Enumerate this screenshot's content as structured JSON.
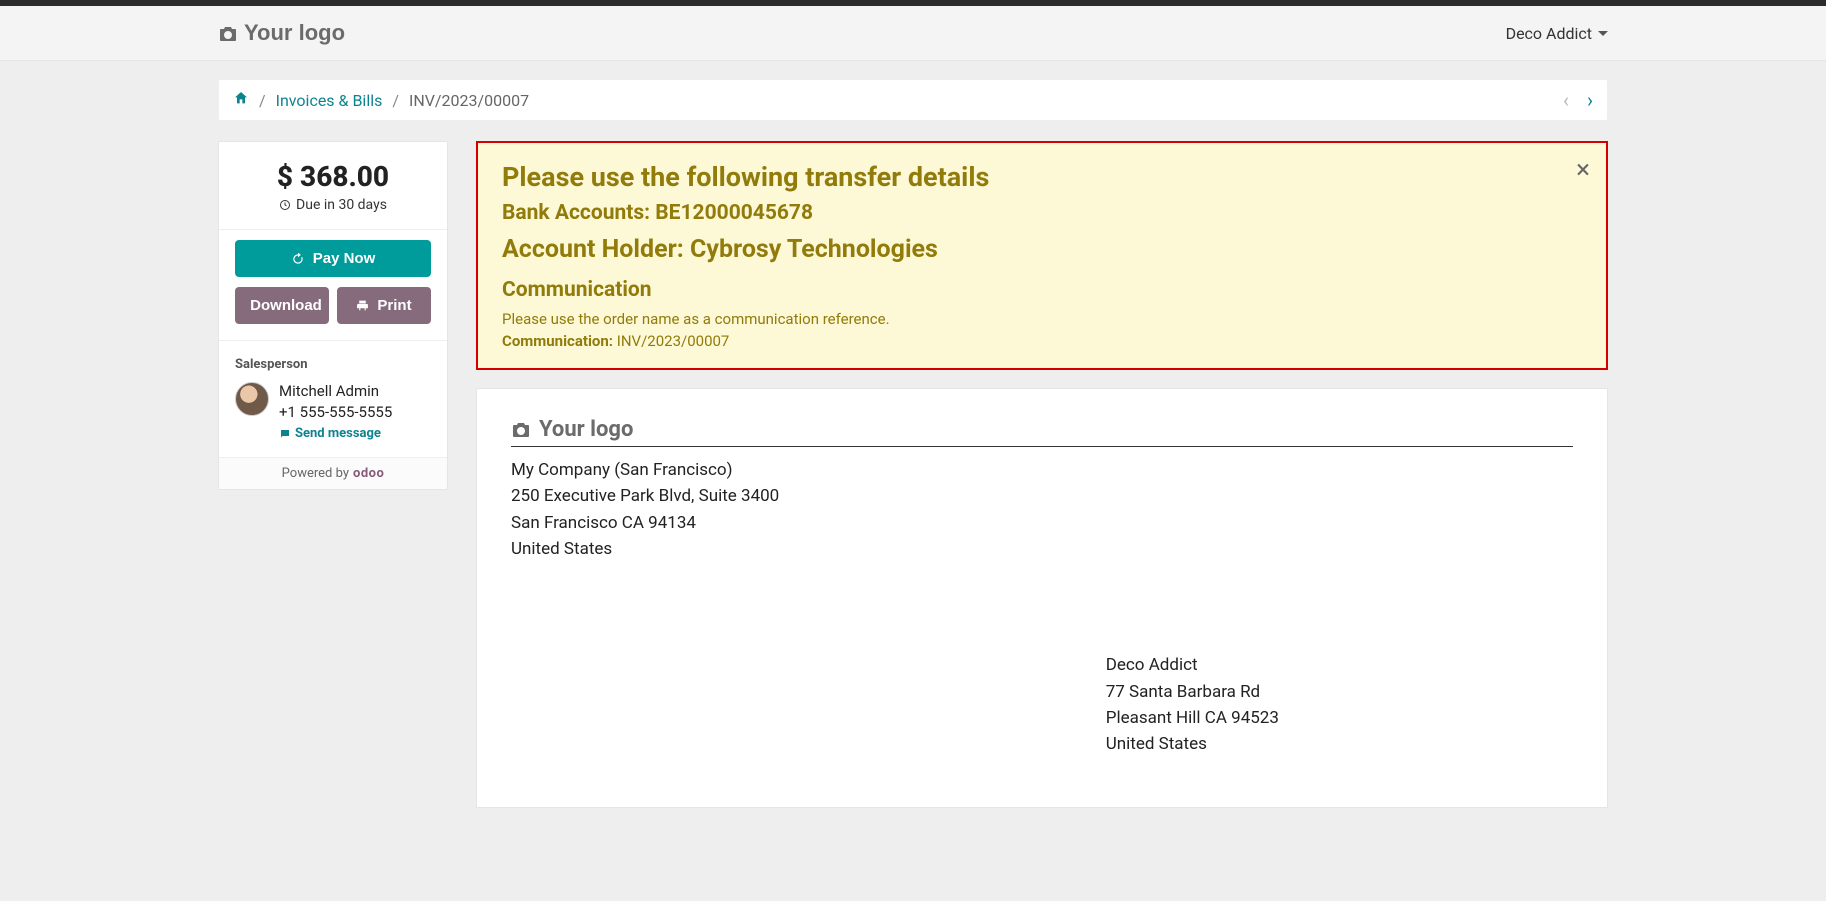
{
  "header": {
    "logo_text": "Your logo",
    "user_name": "Deco Addict"
  },
  "breadcrumb": {
    "home_label": "Home",
    "invoices_label": "Invoices & Bills",
    "current": "INV/2023/00007"
  },
  "sidebar": {
    "amount": "$ 368.00",
    "due_text": "Due in 30 days",
    "pay_label": "Pay Now",
    "download_label": "Download",
    "print_label": "Print",
    "salesperson_heading": "Salesperson",
    "salesperson_name": "Mitchell Admin",
    "salesperson_phone": "+1 555-555-5555",
    "send_message_label": "Send message",
    "powered_by": "Powered by",
    "odoo": "odoo"
  },
  "alert": {
    "title": "Please use the following transfer details",
    "bank_label": "Bank Accounts:",
    "bank_value": "BE12000045678",
    "holder_label": "Account Holder:",
    "holder_value": "Cybrosy Technologies",
    "comm_heading": "Communication",
    "comm_text": "Please use the order name as a communication reference.",
    "comm_label": "Communication:",
    "comm_value": "INV/2023/00007"
  },
  "document": {
    "logo_text": "Your logo",
    "company": {
      "name": "My Company (San Francisco)",
      "street": "250 Executive Park Blvd, Suite 3400",
      "city_line": "San Francisco CA 94134",
      "country": "United States"
    },
    "customer": {
      "name": "Deco Addict",
      "street": "77 Santa Barbara Rd",
      "city_line": "Pleasant Hill CA 94523",
      "country": "United States"
    }
  }
}
